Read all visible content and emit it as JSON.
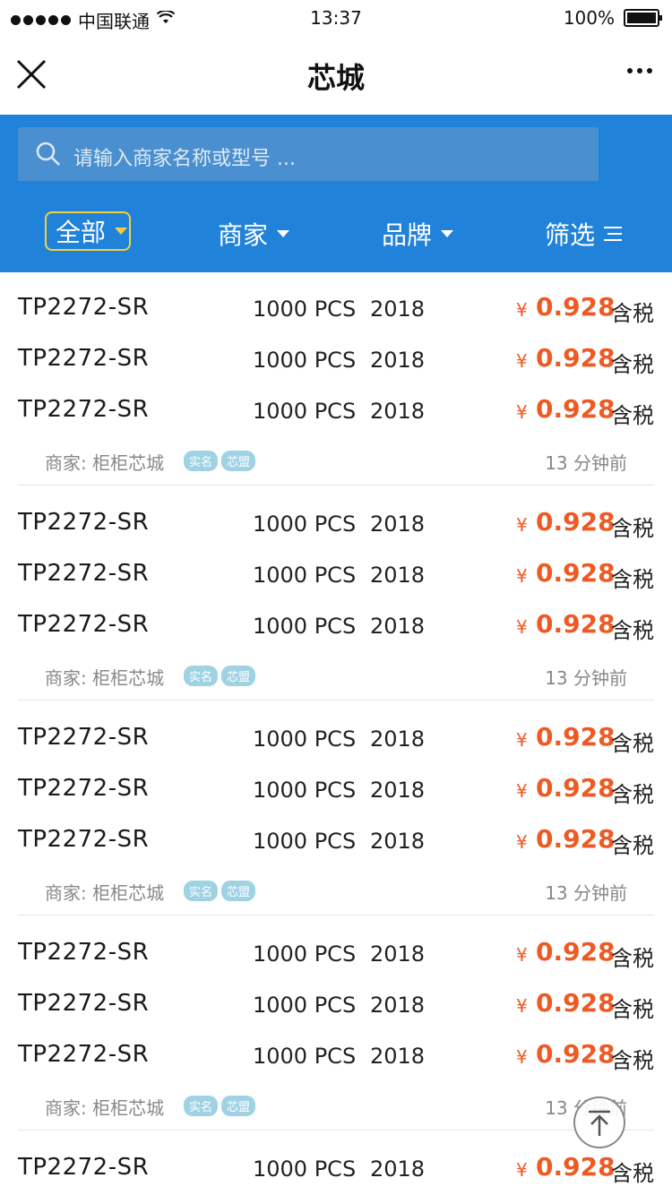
{
  "status_bar": {
    "carrier": "中国联通",
    "time": "13:37",
    "battery": "100%"
  },
  "nav": {
    "title": "芯城"
  },
  "search": {
    "placeholder": "请输入商家名称或型号 ..."
  },
  "filters": {
    "all": "全部",
    "merchant": "商家",
    "brand": "品牌",
    "filter": "筛选"
  },
  "colors": {
    "header_blue": "#2182d9",
    "price_orange": "#ee5a24",
    "active_border": "#f4d03f"
  },
  "listings": [
    {
      "rows": [
        {
          "part": "TP2272-SR",
          "qty": "1000 PCS",
          "year": "2018",
          "currency": "¥",
          "price": "0.928",
          "tax": "含税"
        },
        {
          "part": "TP2272-SR",
          "qty": "1000 PCS",
          "year": "2018",
          "currency": "¥",
          "price": "0.928",
          "tax": "含税"
        },
        {
          "part": "TP2272-SR",
          "qty": "1000 PCS",
          "year": "2018",
          "currency": "¥",
          "price": "0.928",
          "tax": "含税"
        }
      ],
      "merchant": "商家: 柜柜芯城",
      "badges": [
        "实名",
        "芯盟"
      ],
      "time": "13 分钟前"
    },
    {
      "rows": [
        {
          "part": "TP2272-SR",
          "qty": "1000 PCS",
          "year": "2018",
          "currency": "¥",
          "price": "0.928",
          "tax": "含税"
        },
        {
          "part": "TP2272-SR",
          "qty": "1000 PCS",
          "year": "2018",
          "currency": "¥",
          "price": "0.928",
          "tax": "含税"
        },
        {
          "part": "TP2272-SR",
          "qty": "1000 PCS",
          "year": "2018",
          "currency": "¥",
          "price": "0.928",
          "tax": "含税"
        }
      ],
      "merchant": "商家: 柜柜芯城",
      "badges": [
        "实名",
        "芯盟"
      ],
      "time": "13 分钟前"
    },
    {
      "rows": [
        {
          "part": "TP2272-SR",
          "qty": "1000 PCS",
          "year": "2018",
          "currency": "¥",
          "price": "0.928",
          "tax": "含税"
        },
        {
          "part": "TP2272-SR",
          "qty": "1000 PCS",
          "year": "2018",
          "currency": "¥",
          "price": "0.928",
          "tax": "含税"
        },
        {
          "part": "TP2272-SR",
          "qty": "1000 PCS",
          "year": "2018",
          "currency": "¥",
          "price": "0.928",
          "tax": "含税"
        }
      ],
      "merchant": "商家: 柜柜芯城",
      "badges": [
        "实名",
        "芯盟"
      ],
      "time": "13 分钟前"
    },
    {
      "rows": [
        {
          "part": "TP2272-SR",
          "qty": "1000 PCS",
          "year": "2018",
          "currency": "¥",
          "price": "0.928",
          "tax": "含税"
        },
        {
          "part": "TP2272-SR",
          "qty": "1000 PCS",
          "year": "2018",
          "currency": "¥",
          "price": "0.928",
          "tax": "含税"
        },
        {
          "part": "TP2272-SR",
          "qty": "1000 PCS",
          "year": "2018",
          "currency": "¥",
          "price": "0.928",
          "tax": "含税"
        }
      ],
      "merchant": "商家: 柜柜芯城",
      "badges": [
        "实名",
        "芯盟"
      ],
      "time": "13 分钟前"
    },
    {
      "rows": [
        {
          "part": "TP2272-SR",
          "qty": "1000 PCS",
          "year": "2018",
          "currency": "¥",
          "price": "0.928",
          "tax": "含税"
        }
      ]
    }
  ]
}
